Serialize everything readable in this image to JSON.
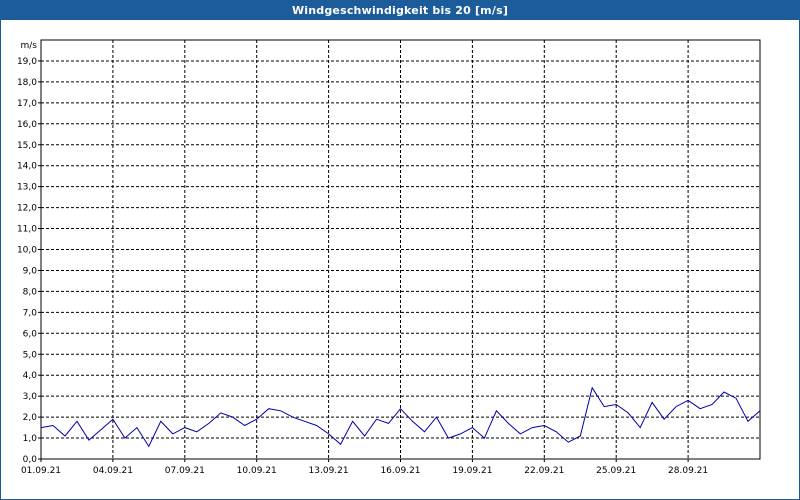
{
  "window": {
    "title": "Windgeschwindigkeit bis 20 [m/s]"
  },
  "colors": {
    "title_bar": "#1c5c9a",
    "series": "#0000aa",
    "grid": "#000000"
  },
  "chart_data": {
    "type": "line",
    "title": "Windgeschwindigkeit bis 20 [m/s]",
    "ylabel": "m/s",
    "xlabel": "",
    "ylim": [
      0,
      20
    ],
    "xlim": [
      "2021-09-01",
      "2021-10-01"
    ],
    "grid": true,
    "y_ticks": [
      "0,0",
      "1,0",
      "2,0",
      "3,0",
      "4,0",
      "5,0",
      "6,0",
      "7,0",
      "8,0",
      "9,0",
      "10,0",
      "11,0",
      "12,0",
      "13,0",
      "14,0",
      "15,0",
      "16,0",
      "17,0",
      "18,0",
      "19,0"
    ],
    "x_ticks": [
      "01.09.21",
      "04.09.21",
      "07.09.21",
      "10.09.21",
      "13.09.21",
      "16.09.21",
      "19.09.21",
      "22.09.21",
      "25.09.21",
      "28.09.21"
    ],
    "series": [
      {
        "x": [
          "2021-09-01",
          "2021-09-01T12:00",
          "2021-09-02",
          "2021-09-02T12:00",
          "2021-09-03",
          "2021-09-03T12:00",
          "2021-09-04",
          "2021-09-04T12:00",
          "2021-09-05",
          "2021-09-05T12:00",
          "2021-09-06",
          "2021-09-06T12:00",
          "2021-09-07",
          "2021-09-07T12:00",
          "2021-09-08",
          "2021-09-08T12:00",
          "2021-09-09",
          "2021-09-09T12:00",
          "2021-09-10",
          "2021-09-10T12:00",
          "2021-09-11",
          "2021-09-11T12:00",
          "2021-09-12",
          "2021-09-12T12:00",
          "2021-09-13",
          "2021-09-13T12:00",
          "2021-09-14",
          "2021-09-14T12:00",
          "2021-09-15",
          "2021-09-15T12:00",
          "2021-09-16",
          "2021-09-16T12:00",
          "2021-09-17",
          "2021-09-17T12:00",
          "2021-09-18",
          "2021-09-18T12:00",
          "2021-09-19",
          "2021-09-19T12:00",
          "2021-09-20",
          "2021-09-20T12:00",
          "2021-09-21",
          "2021-09-21T12:00",
          "2021-09-22",
          "2021-09-22T12:00",
          "2021-09-23",
          "2021-09-23T12:00",
          "2021-09-24",
          "2021-09-24T12:00",
          "2021-09-25",
          "2021-09-25T12:00",
          "2021-09-26",
          "2021-09-26T12:00",
          "2021-09-27",
          "2021-09-27T12:00",
          "2021-09-28",
          "2021-09-28T12:00",
          "2021-09-29",
          "2021-09-29T12:00",
          "2021-09-30",
          "2021-09-30T12:00",
          "2021-10-01"
        ],
        "values": [
          1.5,
          1.6,
          1.1,
          1.8,
          0.9,
          1.4,
          1.9,
          1.0,
          1.5,
          0.6,
          1.8,
          1.2,
          1.5,
          1.3,
          1.7,
          2.2,
          2.0,
          1.6,
          1.9,
          2.4,
          2.3,
          2.0,
          1.8,
          1.6,
          1.2,
          0.7,
          1.8,
          1.1,
          1.9,
          1.7,
          2.4,
          1.8,
          1.3,
          2.0,
          1.0,
          1.2,
          1.5,
          1.0,
          2.3,
          1.7,
          1.2,
          1.5,
          1.6,
          1.3,
          0.8,
          1.1,
          3.4,
          2.5,
          2.6,
          2.2,
          1.5,
          2.7,
          1.9,
          2.5,
          2.8,
          2.4,
          2.6,
          3.2,
          2.9,
          1.8,
          2.3
        ]
      }
    ]
  }
}
